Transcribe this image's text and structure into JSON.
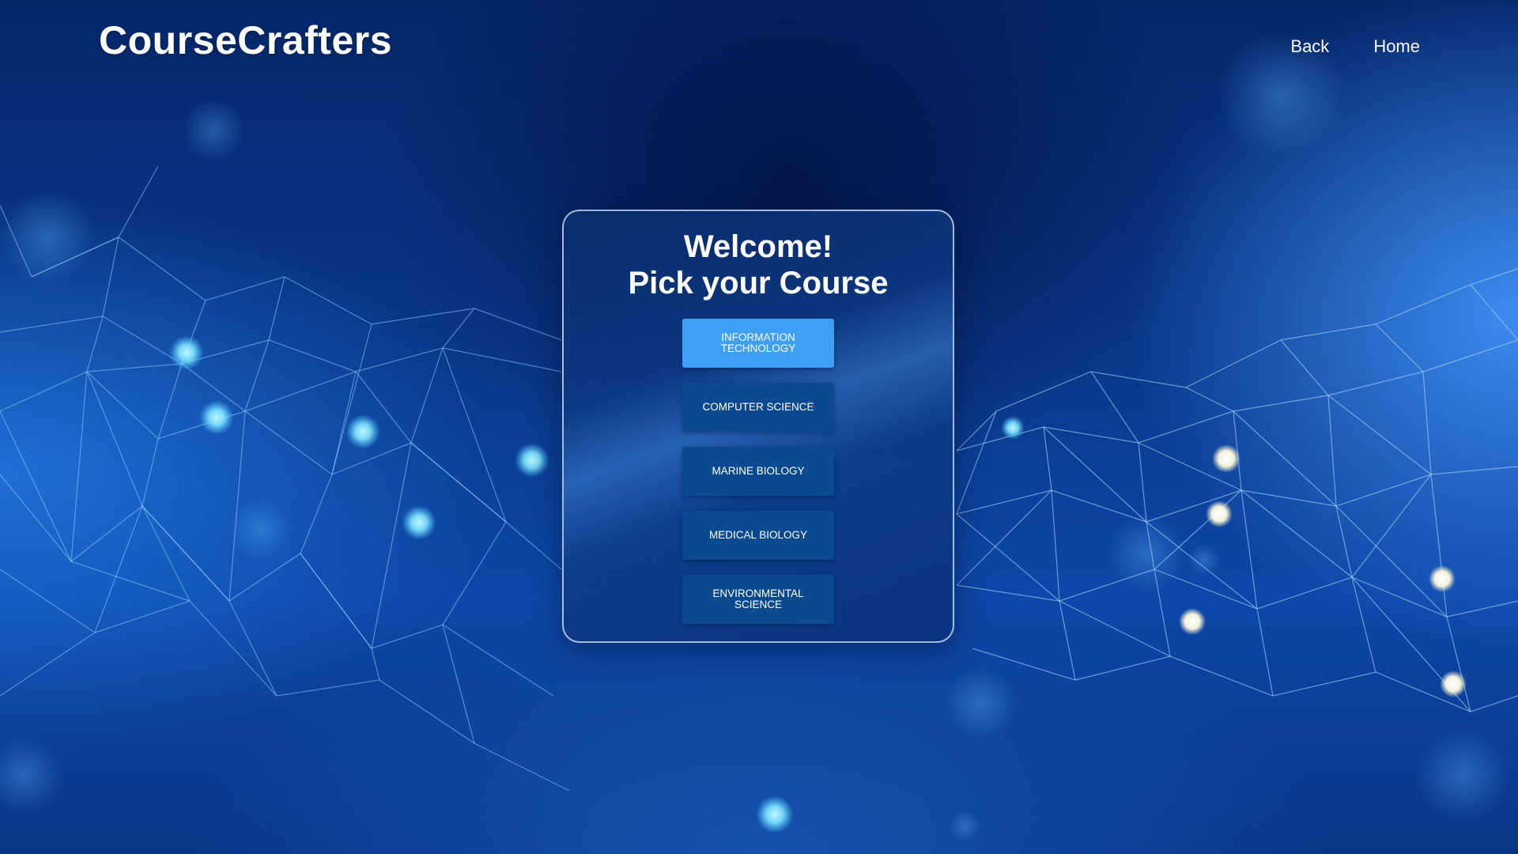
{
  "brand": {
    "name": "CourseCrafters"
  },
  "nav": {
    "back_label": "Back",
    "home_label": "Home"
  },
  "card": {
    "title_line1": "Welcome!",
    "title_line2": "Pick your Course"
  },
  "courses": [
    {
      "label": "INFORMATION TECHNOLOGY",
      "selected": true
    },
    {
      "label": "COMPUTER SCIENCE",
      "selected": false
    },
    {
      "label": "MARINE BIOLOGY",
      "selected": false
    },
    {
      "label": "MEDICAL BIOLOGY",
      "selected": false
    },
    {
      "label": "ENVIRONMENTAL SCIENCE",
      "selected": false
    }
  ],
  "colors": {
    "button": "#0c4a8f",
    "button_selected": "#3ea0f5",
    "text": "#ffffff"
  },
  "icons": {
    "background": "network-mesh-background"
  }
}
